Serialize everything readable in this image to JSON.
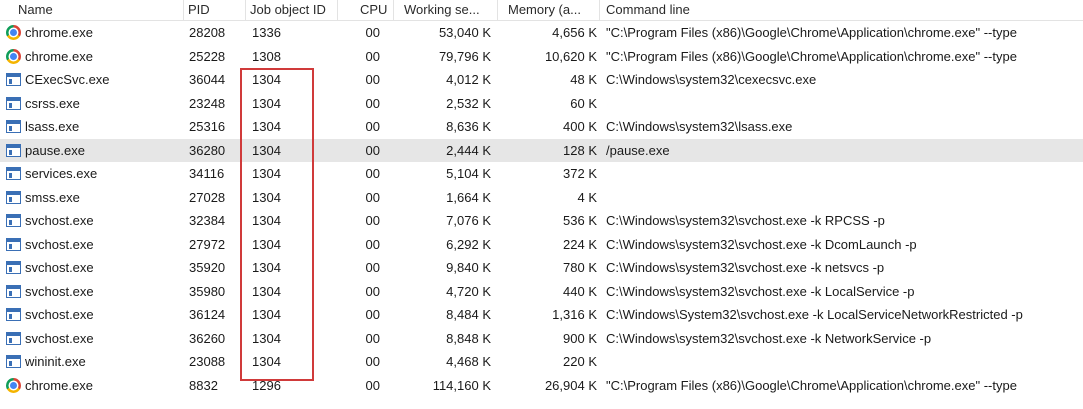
{
  "columns": {
    "name": "Name",
    "pid": "PID",
    "job": "Job object ID",
    "cpu": "CPU",
    "ws": "Working se...",
    "mem": "Memory (a...",
    "cmd": "Command line"
  },
  "rows": [
    {
      "icon": "chrome-icon",
      "name": "chrome.exe",
      "pid": "28208",
      "job": "1336",
      "cpu": "00",
      "ws": "53,040 K",
      "mem": "4,656 K",
      "cmd": "\"C:\\Program Files (x86)\\Google\\Chrome\\Application\\chrome.exe\" --type"
    },
    {
      "icon": "chrome-icon",
      "name": "chrome.exe",
      "pid": "25228",
      "job": "1308",
      "cpu": "00",
      "ws": "79,796 K",
      "mem": "10,620 K",
      "cmd": "\"C:\\Program Files (x86)\\Google\\Chrome\\Application\\chrome.exe\" --type"
    },
    {
      "icon": "app-icon",
      "name": "CExecSvc.exe",
      "pid": "36044",
      "job": "1304",
      "cpu": "00",
      "ws": "4,012 K",
      "mem": "48 K",
      "cmd": "C:\\Windows\\system32\\cexecsvc.exe"
    },
    {
      "icon": "app-icon",
      "name": "csrss.exe",
      "pid": "23248",
      "job": "1304",
      "cpu": "00",
      "ws": "2,532 K",
      "mem": "60 K",
      "cmd": ""
    },
    {
      "icon": "app-icon",
      "name": "lsass.exe",
      "pid": "25316",
      "job": "1304",
      "cpu": "00",
      "ws": "8,636 K",
      "mem": "400 K",
      "cmd": "C:\\Windows\\system32\\lsass.exe"
    },
    {
      "icon": "app-icon",
      "name": "pause.exe",
      "pid": "36280",
      "job": "1304",
      "cpu": "00",
      "ws": "2,444 K",
      "mem": "128 K",
      "cmd": "/pause.exe",
      "selected": true
    },
    {
      "icon": "app-icon",
      "name": "services.exe",
      "pid": "34116",
      "job": "1304",
      "cpu": "00",
      "ws": "5,104 K",
      "mem": "372 K",
      "cmd": ""
    },
    {
      "icon": "app-icon",
      "name": "smss.exe",
      "pid": "27028",
      "job": "1304",
      "cpu": "00",
      "ws": "1,664 K",
      "mem": "4 K",
      "cmd": ""
    },
    {
      "icon": "app-icon",
      "name": "svchost.exe",
      "pid": "32384",
      "job": "1304",
      "cpu": "00",
      "ws": "7,076 K",
      "mem": "536 K",
      "cmd": "C:\\Windows\\system32\\svchost.exe -k RPCSS -p"
    },
    {
      "icon": "app-icon",
      "name": "svchost.exe",
      "pid": "27972",
      "job": "1304",
      "cpu": "00",
      "ws": "6,292 K",
      "mem": "224 K",
      "cmd": "C:\\Windows\\system32\\svchost.exe -k DcomLaunch -p"
    },
    {
      "icon": "app-icon",
      "name": "svchost.exe",
      "pid": "35920",
      "job": "1304",
      "cpu": "00",
      "ws": "9,840 K",
      "mem": "780 K",
      "cmd": "C:\\Windows\\system32\\svchost.exe -k netsvcs -p"
    },
    {
      "icon": "app-icon",
      "name": "svchost.exe",
      "pid": "35980",
      "job": "1304",
      "cpu": "00",
      "ws": "4,720 K",
      "mem": "440 K",
      "cmd": "C:\\Windows\\system32\\svchost.exe -k LocalService -p"
    },
    {
      "icon": "app-icon",
      "name": "svchost.exe",
      "pid": "36124",
      "job": "1304",
      "cpu": "00",
      "ws": "8,484 K",
      "mem": "1,316 K",
      "cmd": "C:\\Windows\\System32\\svchost.exe -k LocalServiceNetworkRestricted -p"
    },
    {
      "icon": "app-icon",
      "name": "svchost.exe",
      "pid": "36260",
      "job": "1304",
      "cpu": "00",
      "ws": "8,848 K",
      "mem": "900 K",
      "cmd": "C:\\Windows\\system32\\svchost.exe -k NetworkService -p"
    },
    {
      "icon": "app-icon",
      "name": "wininit.exe",
      "pid": "23088",
      "job": "1304",
      "cpu": "00",
      "ws": "4,468 K",
      "mem": "220 K",
      "cmd": ""
    },
    {
      "icon": "chrome-icon",
      "name": "chrome.exe",
      "pid": "8832",
      "job": "1296",
      "cpu": "00",
      "ws": "114,160 K",
      "mem": "26,904 K",
      "cmd": "\"C:\\Program Files (x86)\\Google\\Chrome\\Application\\chrome.exe\" --type"
    }
  ],
  "colors": {
    "highlight_box": "#d03a3a",
    "selected_row": "#e6e6e6"
  }
}
